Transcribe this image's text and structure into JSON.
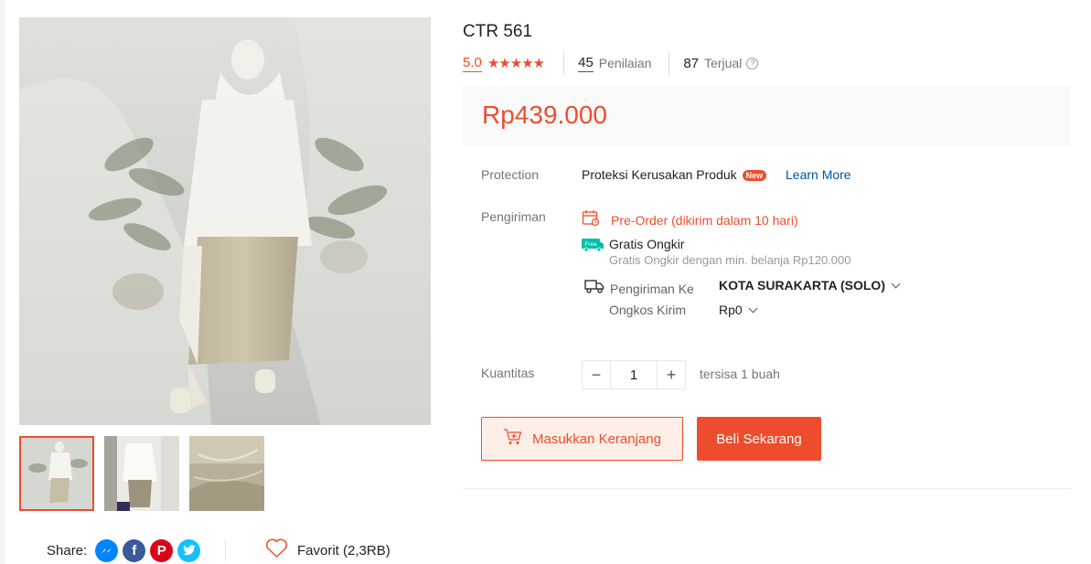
{
  "product": {
    "title": "CTR 561",
    "rating": "5.0",
    "stars": "★★★★★",
    "reviews_count": "45",
    "reviews_label": "Penilaian",
    "sold_count": "87",
    "sold_label": "Terjual",
    "price": "Rp439.000"
  },
  "protection": {
    "label": "Protection",
    "value": "Proteksi Kerusakan Produk",
    "badge": "New",
    "link": "Learn More"
  },
  "shipping": {
    "label": "Pengiriman",
    "preorder": "Pre-Order (dikirim dalam 10 hari)",
    "free_badge": "Free",
    "free_title": "Gratis Ongkir",
    "free_sub": "Gratis Ongkir dengan min. belanja Rp120.000",
    "to_label": "Pengiriman Ke",
    "to_city": "KOTA SURAKARTA (SOLO)",
    "cost_label": "Ongkos Kirim",
    "cost_value": "Rp0"
  },
  "quantity": {
    "label": "Kuantitas",
    "minus": "−",
    "value": "1",
    "plus": "+",
    "stock": "tersisa 1 buah"
  },
  "actions": {
    "cart": "Masukkan Keranjang",
    "buy": "Beli Sekarang"
  },
  "share": {
    "label": "Share:",
    "networks": [
      "messenger-icon",
      "facebook-icon",
      "pinterest-icon",
      "twitter-icon"
    ]
  },
  "favorite": {
    "label": "Favorit (2,3RB)"
  },
  "colors": {
    "accent": "#ee4d2d",
    "link": "#0055aa"
  }
}
